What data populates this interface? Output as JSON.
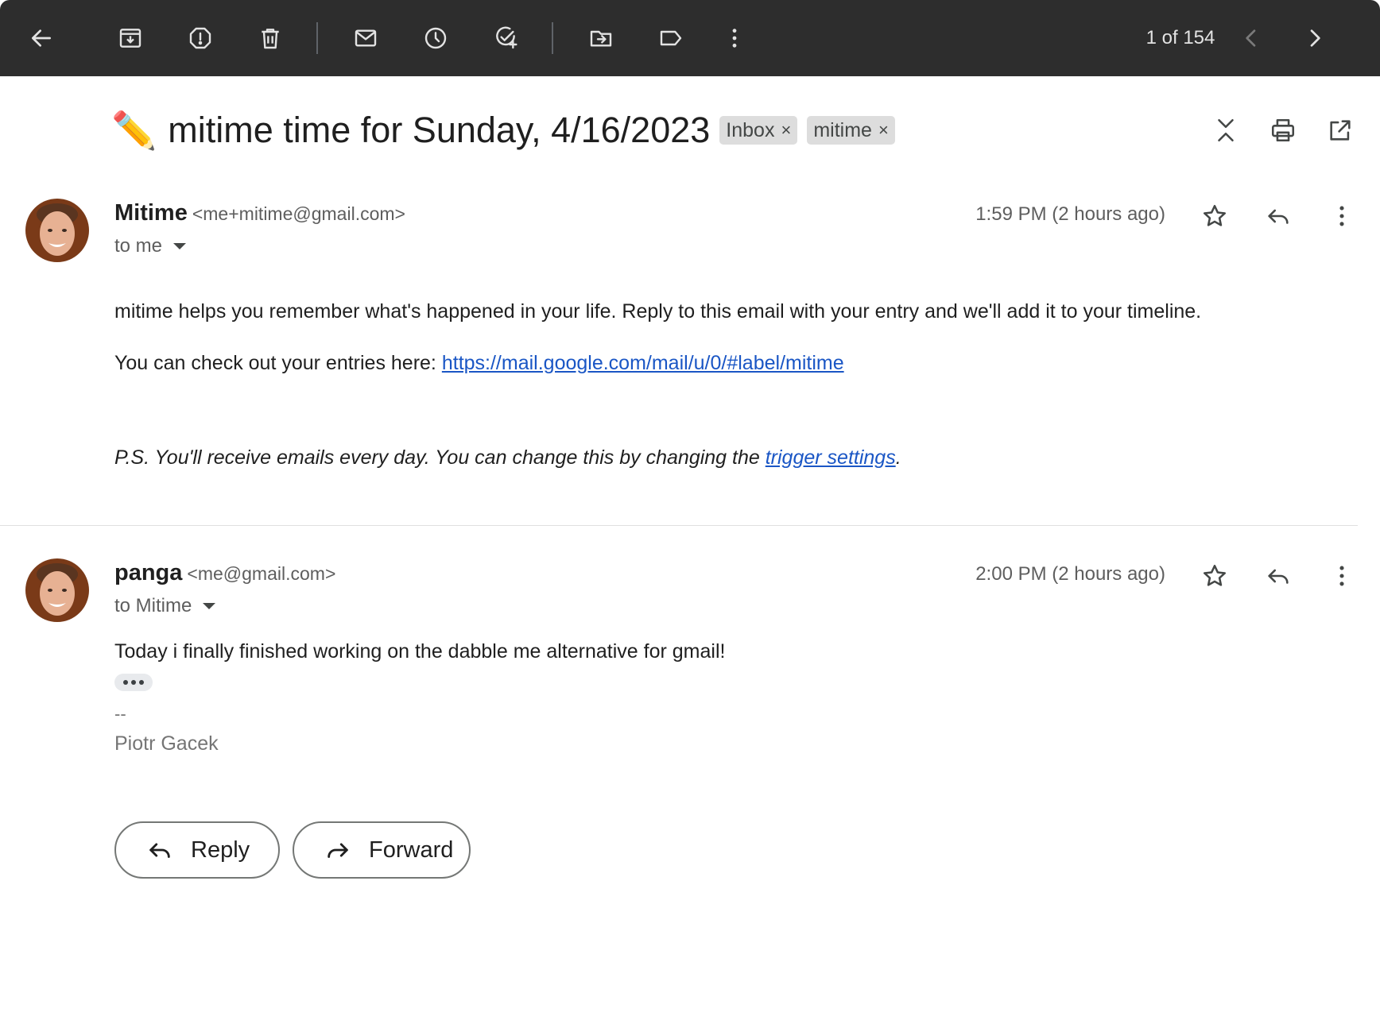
{
  "toolbar": {
    "icons": [
      "back-arrow-icon",
      "archive-icon",
      "report-spam-icon",
      "delete-icon",
      "mark-unread-icon",
      "snooze-icon",
      "add-task-icon",
      "move-to-icon",
      "label-icon",
      "more-vert-icon"
    ],
    "pager": "1 of 154"
  },
  "thread": {
    "emoji": "✏️",
    "subject": "mitime time for Sunday, 4/16/2023",
    "labels": [
      {
        "name": "Inbox",
        "remove": "×"
      },
      {
        "name": "mitime",
        "remove": "×"
      }
    ]
  },
  "messages": [
    {
      "sender_name": "Mitime",
      "sender_email": "<me+mitime@gmail.com>",
      "to": "to me",
      "time": "1:59 PM (2 hours ago)",
      "body": {
        "line1": "mitime helps you remember what's happened in your life. Reply to this email with your entry and we'll add it to your timeline.",
        "line2_prefix": "You can check out your entries here: ",
        "line2_link": "https://mail.google.com/mail/u/0/#label/mitime",
        "ps_prefix": "P.S. You'll receive emails every day. You can change this by changing the ",
        "ps_link": "trigger settings",
        "ps_suffix": "."
      }
    },
    {
      "sender_name": "panga",
      "sender_email": "<me@gmail.com>",
      "to": "to Mitime",
      "time": "2:00 PM (2 hours ago)",
      "body": {
        "line1": "Today i finally finished working on the dabble me alternative for gmail!"
      },
      "signature_dash": "--",
      "signature_name": "Piotr Gacek"
    }
  ],
  "actions": {
    "reply": "Reply",
    "forward": "Forward"
  },
  "colors": {
    "toolbar_bg": "#2d2d2d",
    "link": "#1a56c5",
    "chip_bg": "#dddddd"
  }
}
